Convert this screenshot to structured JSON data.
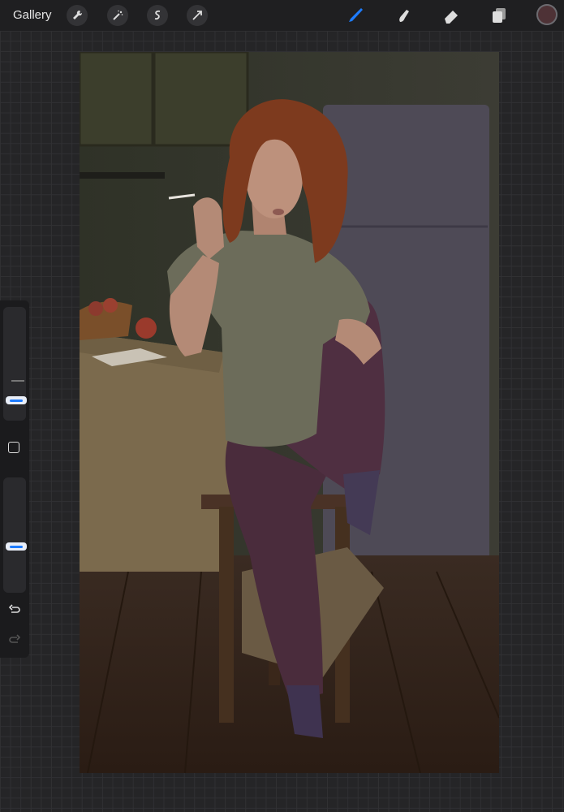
{
  "topbar": {
    "gallery_label": "Gallery",
    "left_tools": [
      "wrench-icon",
      "magic-wand-icon",
      "selection-icon",
      "transform-arrow-icon"
    ],
    "right_tools": [
      "brush-icon",
      "smudge-icon",
      "eraser-icon",
      "layers-icon"
    ],
    "current_color": "#4e3236",
    "active_tool_color": "#1e7cff"
  },
  "sidebar": {
    "brush_size_level": 0.25,
    "opacity_level": 0.35,
    "modify_button": "square-icon",
    "undo": "undo-icon",
    "redo": "redo-icon"
  },
  "canvas": {
    "description_icon": "artwork-canvas"
  }
}
